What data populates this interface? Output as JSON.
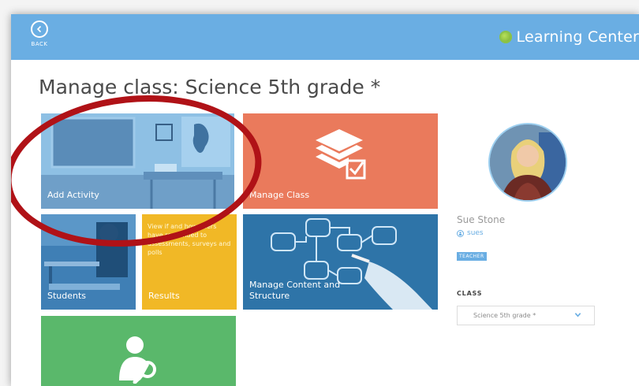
{
  "header": {
    "back_label": "BACK",
    "brand_name": "Learning Center"
  },
  "page": {
    "title": "Manage class: Science 5th grade *"
  },
  "tiles": {
    "add_activity": "Add Activity",
    "manage_class": "Manage Class",
    "students": "Students",
    "results": "Results",
    "results_description": "View if and how users have responded to assessments, surveys and polls",
    "manage_content": "Manage Content and Structure"
  },
  "profile": {
    "name": "Sue Stone",
    "username": "sues",
    "role": "TEACHER",
    "class_label": "CLASS",
    "class_selected": "Science 5th grade *"
  },
  "colors": {
    "header": "#6aaee3",
    "add_tile": "#7fb4dc",
    "manage_tile": "#ea7a5c",
    "students_tile": "#3f7fb5",
    "results_tile": "#f1b826",
    "content_tile": "#2e74a8",
    "green_tile": "#5ab86b",
    "highlight": "#b01217"
  },
  "icons": {
    "back": "back-arrow-icon",
    "brand": "learning-center-logo-icon",
    "manage": "layers-check-icon",
    "user_search": "user-search-icon",
    "handle": "user-circle-icon",
    "dropdown": "chevron-down-icon"
  }
}
